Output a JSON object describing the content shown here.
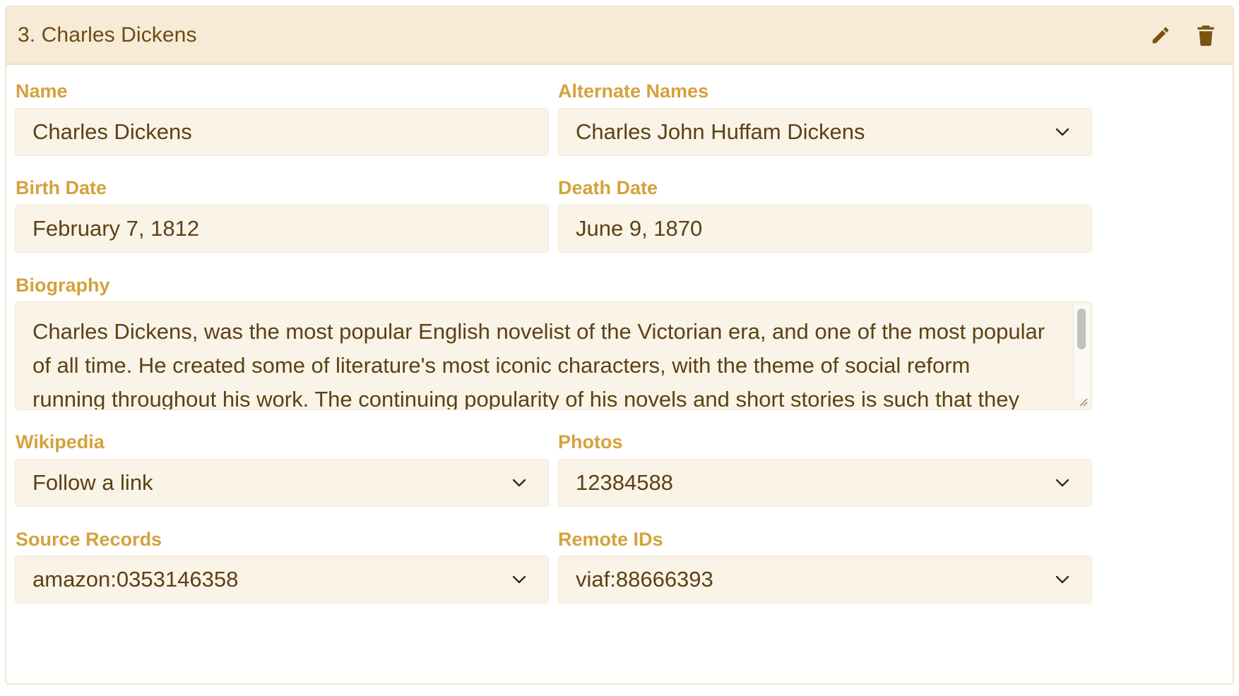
{
  "header": {
    "title": "3. Charles Dickens",
    "edit_icon": "pencil-icon",
    "delete_icon": "trash-icon"
  },
  "fields": {
    "name": {
      "label": "Name",
      "value": "Charles Dickens"
    },
    "alternate_names": {
      "label": "Alternate Names",
      "value": "Charles John Huffam Dickens"
    },
    "birth_date": {
      "label": "Birth Date",
      "value": "February 7, 1812"
    },
    "death_date": {
      "label": "Death Date",
      "value": "June 9, 1870"
    },
    "biography": {
      "label": "Biography",
      "value": "Charles Dickens, was the most popular English novelist of the Victorian era, and one of the most popular of all time. He created some of literature's most iconic characters, with the theme of social reform running throughout his work. The continuing popularity of his novels and short stories is such that they have never gone out of print."
    },
    "wikipedia": {
      "label": "Wikipedia",
      "value": "Follow a link"
    },
    "photos": {
      "label": "Photos",
      "value": "12384588"
    },
    "source_records": {
      "label": "Source Records",
      "value": "amazon:0353146358"
    },
    "remote_ids": {
      "label": "Remote IDs",
      "value": "viaf:88666393"
    }
  },
  "colors": {
    "header_bg": "#f7ead6",
    "label": "#d4a23c",
    "field_bg": "#faf3e7",
    "text": "#5b4214",
    "icon": "#7a5512"
  }
}
